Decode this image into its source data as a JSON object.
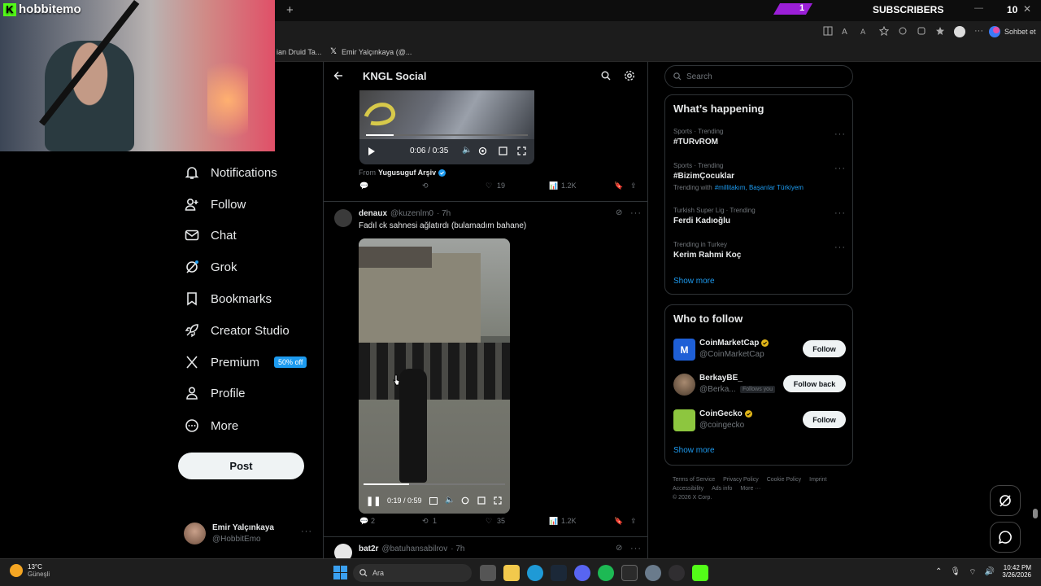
{
  "stream": {
    "brand": "hobbitemo",
    "subscribers_label": "SUBSCRIBERS",
    "subscribers_count": "10",
    "badge_count": "1"
  },
  "browser": {
    "tabs": [
      {
        "label": "ian Druid Ta..."
      },
      {
        "label": "Emir Yalçınkaya (@..."
      }
    ],
    "chat_button": "Sohbet et"
  },
  "nav": {
    "items": [
      {
        "label": "Notifications",
        "icon": "bell-icon"
      },
      {
        "label": "Follow",
        "icon": "person-plus-icon"
      },
      {
        "label": "Chat",
        "icon": "mail-icon"
      },
      {
        "label": "Grok",
        "icon": "grok-icon"
      },
      {
        "label": "Bookmarks",
        "icon": "bookmark-icon"
      },
      {
        "label": "Creator Studio",
        "icon": "rocket-icon"
      },
      {
        "label": "Premium",
        "icon": "x-logo-icon"
      },
      {
        "label": "Profile",
        "icon": "person-icon"
      },
      {
        "label": "More",
        "icon": "more-circle-icon"
      }
    ],
    "premium_badge": "50% off",
    "post_label": "Post"
  },
  "account": {
    "name": "Emir Yalçınkaya",
    "handle": "@HobbitEmo"
  },
  "community": {
    "title": "KNGL Social"
  },
  "tweet1": {
    "video_time": "0:06 / 0:35",
    "video_progress": 0.17,
    "from_label": "From",
    "from_name": "Yugusuguf Arşiv",
    "likes": "19",
    "views": "1.2K"
  },
  "tweet2": {
    "name": "denaux",
    "handle": "@kuzenlm0",
    "time": "· 7h",
    "text": "Fadıl ck sahnesi ağlatırdı (bulamadım bahane)",
    "video_time": "0:19 / 0:59",
    "video_progress": 0.32,
    "replies": "2",
    "reposts": "1",
    "likes": "35",
    "views": "1.2K"
  },
  "tweet3": {
    "name": "bat2r",
    "handle": "@batuhansabilrov",
    "time": "· 7h"
  },
  "search": {
    "placeholder": "Search"
  },
  "happening": {
    "title": "What’s happening",
    "trends": [
      {
        "category": "Sports · Trending",
        "name": "#TURvROM"
      },
      {
        "category": "Sports · Trending",
        "name": "#BizimÇocuklar",
        "with_label": "Trending with",
        "with_tags": "#millitakım, Başarılar Türkiyem"
      },
      {
        "category": "Turkish Super Lig · Trending",
        "name": "Ferdi Kadıoğlu"
      },
      {
        "category": "Trending in Turkey",
        "name": "Kerim Rahmi Koç"
      }
    ],
    "show_more": "Show more"
  },
  "who_to_follow": {
    "title": "Who to follow",
    "accounts": [
      {
        "name": "CoinMarketCap",
        "handle": "@CoinMarketCap",
        "button": "Follow",
        "color": "#1e5fd6"
      },
      {
        "name": "BerkayBE_",
        "handle": "@Berka...",
        "follows_you": "Follows you",
        "button": "Follow back",
        "color": "#5a4a3a"
      },
      {
        "name": "CoinGecko",
        "handle": "@coingecko",
        "button": "Follow",
        "color": "#8dc63f"
      }
    ],
    "show_more": "Show more"
  },
  "footer": {
    "links": [
      "Terms of Service",
      "Privacy Policy",
      "Cookie Policy",
      "Imprint",
      "Accessibility",
      "Ads info",
      "More ···"
    ],
    "copyright": "© 2026 X Corp."
  },
  "taskbar": {
    "weather_temp": "13°C",
    "weather_place": "Güneşli",
    "search_placeholder": "Ara",
    "time": "10:42 PM",
    "date": "3/26/2026"
  },
  "colors": {
    "accent": "#1d9bf0",
    "kick_green": "#53fc18",
    "sub_bar": "#9b1fd8"
  }
}
